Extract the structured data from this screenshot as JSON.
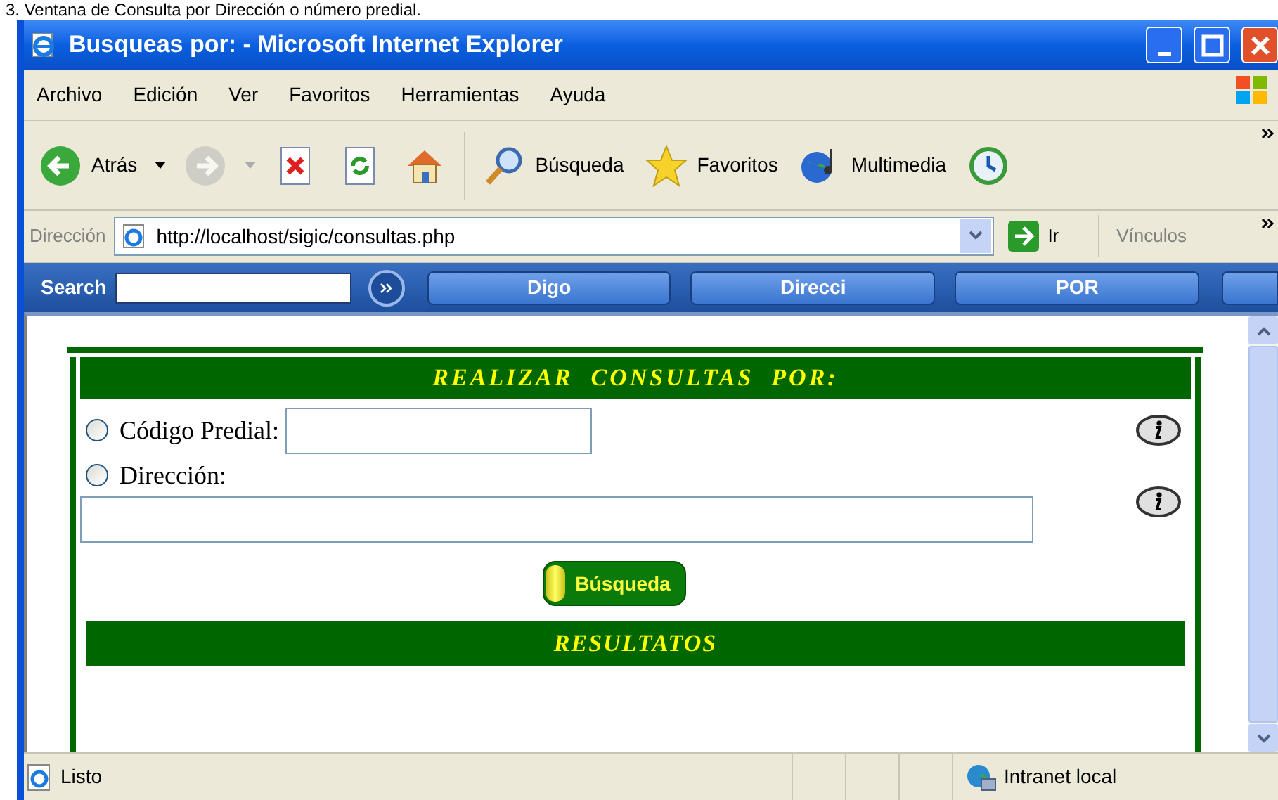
{
  "caption": "3. Ventana de Consulta por Dirección o número predial.",
  "window": {
    "title": "Busqueas por: - Microsoft Internet Explorer"
  },
  "menu": [
    "Archivo",
    "Edición",
    "Ver",
    "Favoritos",
    "Herramientas",
    "Ayuda"
  ],
  "toolbar": [
    {
      "kind": "back",
      "label": "Atrás",
      "disabled": false
    },
    {
      "kind": "forward",
      "disabled": true
    },
    {
      "kind": "stop"
    },
    {
      "kind": "refresh"
    },
    {
      "kind": "home"
    },
    {
      "kind": "search",
      "label": "Búsqueda"
    },
    {
      "kind": "favorites",
      "label": "Favoritos"
    },
    {
      "kind": "media",
      "label": "Multimedia"
    },
    {
      "kind": "history"
    }
  ],
  "address_bar": {
    "label": "Dirección",
    "url": "http://localhost/sigic/consultas.php",
    "go": "Ir",
    "links": "Vínculos"
  },
  "search_bar": {
    "label": "Search",
    "buttons": [
      "Digo",
      "Direcci",
      "POR"
    ]
  },
  "form": {
    "heading": "REALIZAR CONSULTAS POR:",
    "options": [
      {
        "label": "Código Predial:",
        "selected": false
      },
      {
        "label": "Dirección:",
        "selected": false
      }
    ],
    "button": "Búsqueda",
    "results_heading": "RESULTATOS"
  },
  "status_bar": {
    "text": "Listo",
    "zone": "Intranet local"
  }
}
